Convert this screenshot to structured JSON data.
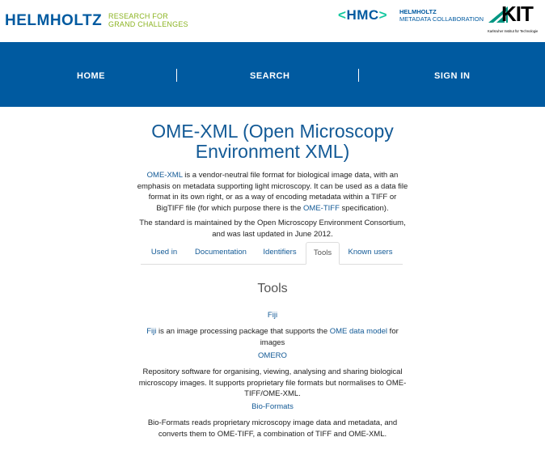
{
  "header": {
    "helmholtz": "HELMHOLTZ",
    "helmholtz_tagline_1": "RESEARCH FOR",
    "helmholtz_tagline_2": "GRAND CHALLENGES",
    "hmc": "HMC",
    "hmc_line1": "HELMHOLTZ",
    "hmc_line2": "METADATA COLLABORATION",
    "kit": "KIT",
    "kit_sub": "Karlsruher Institut für Technologie"
  },
  "nav": {
    "home": "HOME",
    "search": "SEARCH",
    "signin": "SIGN IN"
  },
  "page": {
    "title_line1": "OME-XML (Open Microscopy",
    "title_line2": "Environment XML)",
    "desc_link1": "OME-XML",
    "desc_part1": " is a vendor-neutral file format for biological image data, with an emphasis on metadata supporting light microscopy. It can be used as a data file format in its own right, or as a way of encoding metadata within a TIFF or BigTIFF file (for which purpose there is the ",
    "desc_link2": "OME-TIFF",
    "desc_part2": " specification).",
    "maintained": "The standard is maintained by the Open Microscopy Environment Consortium, and was last updated in June 2012."
  },
  "tabs": {
    "used_in": "Used in",
    "documentation": "Documentation",
    "identifiers": "Identifiers",
    "tools": "Tools",
    "known_users": "Known users"
  },
  "tools": {
    "heading": "Tools",
    "fiji_name": "Fiji",
    "fiji_link": "Fiji",
    "fiji_part1": " is an image processing package that supports the ",
    "fiji_link2": "OME data model",
    "fiji_part2": " for images",
    "omero_name": "OMERO",
    "omero_desc": "Repository software for organising, viewing, analysing and sharing biological microscopy images. It supports proprietary file formats but normalises to OME-TIFF/OME-XML.",
    "bio_name": "Bio-Formats",
    "bio_desc": "Bio-Formats reads proprietary microscopy image data and metadata, and converts them to OME-TIFF, a combination of TIFF and OME-XML."
  },
  "colors": {
    "brand_blue": "#005aa0",
    "link": "#135a96",
    "helmholtz_green": "#8cb423"
  }
}
